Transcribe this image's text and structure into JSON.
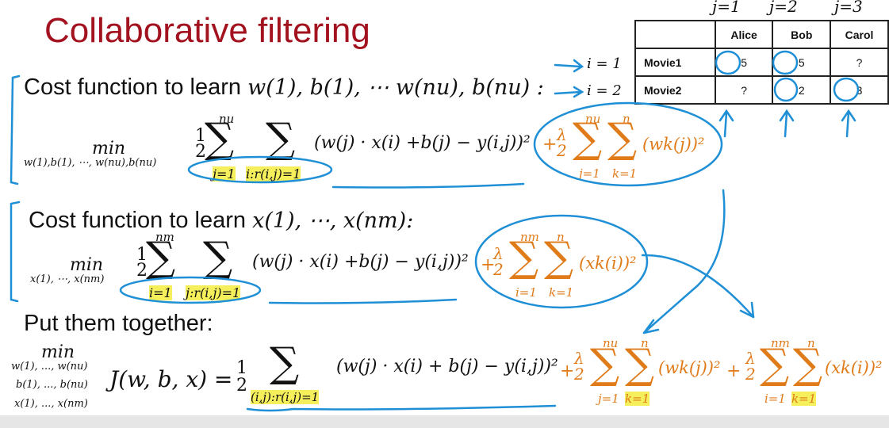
{
  "title": "Collaborative filtering",
  "table": {
    "j_labels": [
      "j=1",
      "j=2",
      "j=3"
    ],
    "i_labels": [
      "i = 1",
      "i = 2"
    ],
    "columns": [
      "Alice",
      "Bob",
      "Carol"
    ],
    "rows": [
      {
        "movie": "Movie1",
        "ratings": [
          "5",
          "5",
          "?"
        ]
      },
      {
        "movie": "Movie2",
        "ratings": [
          "?",
          "2",
          "3"
        ]
      }
    ]
  },
  "section1": {
    "heading_text": "Cost function to learn ",
    "heading_math": "w(1), b(1), ⋯ w(nu), b(nu) :",
    "min_sub": "w(1),b(1), ⋯, w(nu),b(nu)",
    "sum1_top": "nu",
    "sum1_bottom": "j=1",
    "sum2_bottom": "i:r(i,j)=1",
    "term": "(w(j) · x(i) +b(j) − y(i,j))²",
    "reg_top1": "nu",
    "reg_top2": "n",
    "reg_bottom1": "j=1",
    "reg_bottom2": "k=1",
    "reg_term": "(wk(j))²"
  },
  "section2": {
    "heading_text": "Cost function to learn ",
    "heading_math": "x(1), ⋯, x(nm):",
    "min_sub": "x(1), ⋯, x(nm)",
    "sum1_top": "nm",
    "sum1_bottom": "i=1",
    "sum2_bottom": "j:r(i,j)=1",
    "term": "(w(j) · x(i) +b(j) − y(i,j))²",
    "reg_top1": "nm",
    "reg_top2": "n",
    "reg_bottom1": "i=1",
    "reg_bottom2": "k=1",
    "reg_term": "(xk(i))²"
  },
  "section3": {
    "heading": "Put them together:",
    "min_sub_1": "w(1), ..., w(nu)",
    "min_sub_2": "b(1), ..., b(nu)",
    "min_sub_3": "x(1), ..., x(nm)",
    "lhs": "J(w, b, x) =",
    "half": "1/2",
    "sum_bottom": "(i,j):r(i,j)=1",
    "term": "(w(j) · x(i) + b(j) − y(i,j))²",
    "reg1_top1": "nu",
    "reg1_top2": "n",
    "reg1_bottom1": "j=1",
    "reg1_bottom2": "k=1",
    "reg1_term": "(wk(j))²",
    "reg2_top1": "nm",
    "reg2_top2": "n",
    "reg2_bottom1": "i=1",
    "reg2_bottom2": "k=1",
    "reg2_term": "(xk(i))²"
  },
  "colors": {
    "title": "#a3121f",
    "regularization": "#e07b1a",
    "annotation": "#1f8fd6",
    "highlight": "#f4ef5a"
  }
}
